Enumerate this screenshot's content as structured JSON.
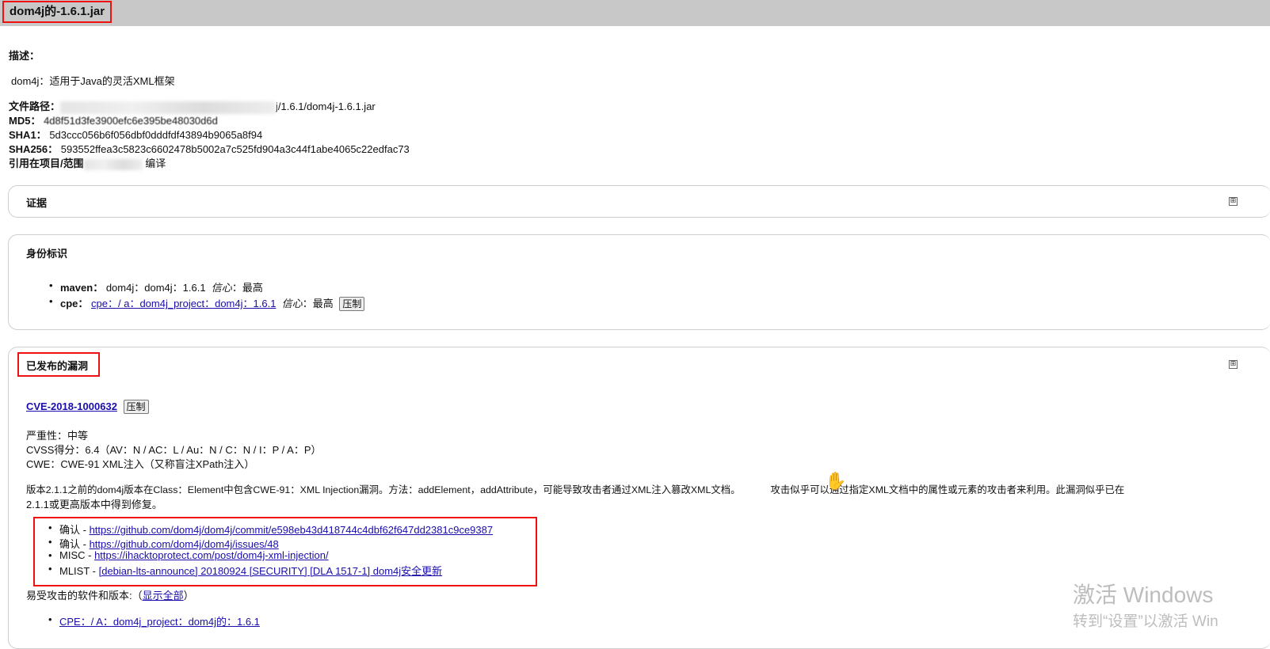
{
  "header": {
    "title": "dom4j的-1.6.1.jar"
  },
  "description": {
    "label": "描述：",
    "text": "dom4j：适用于Java的灵活XML框架"
  },
  "file_path": {
    "label": "文件路径：",
    "suffix": "j/1.6.1/dom4j-1.6.1.jar"
  },
  "md5": {
    "label": "MD5：",
    "value": "4d8f51d3fe3900efc6e395be48030d6d"
  },
  "sha1": {
    "label": "SHA1：",
    "value": "5d3ccc056b6f056dbf0dddfdf43894b9065a8f94"
  },
  "sha256": {
    "label": "SHA256：",
    "value": "593552ffea3c5823c6602478b5002a7c525fd904a3c44f1abe4065c22edfac73"
  },
  "scope": {
    "label": "引用在项目/范围",
    "value": "编译"
  },
  "evidence": {
    "title": "证据",
    "toggle": "⊞"
  },
  "identity": {
    "title": "身份标识",
    "maven": {
      "label": "maven：",
      "value": "dom4j：dom4j：1.6.1",
      "conf_label": "信心",
      "conf_value": "：最高"
    },
    "cpe": {
      "label": "cpe：",
      "link": "cpe：/ a：dom4j_project：dom4j：1.6.1",
      "conf_label": "信心",
      "conf_value": "：最高",
      "suppress": "压制"
    }
  },
  "vulns": {
    "title": "已发布的漏洞",
    "toggle": "⊞",
    "cve_id": "CVE-2018-1000632",
    "suppress": "压制",
    "severity": "严重性：中等",
    "cvss": "CVSS得分：6.4（AV：N / AC：L / Au：N / C：N / I：P / A：P）",
    "cwe": "CWE：CWE-91 XML注入（又称盲注XPath注入）",
    "desc_line1a": "版本2.1.1之前的dom4j版本在Class：Element中包含CWE-91：XML Injection漏洞。方法：addElement，addAttribute，可能导致攻击者通过XML注入篡改XML文档。",
    "desc_line1b": "攻击似乎可以通过指定XML文档中的属性或元素的攻击者来利用。此漏洞似乎已在",
    "desc_line2": "2.1.1或更高版本中得到修复。",
    "refs": [
      {
        "type": "确认 - ",
        "url": "https://github.com/dom4j/dom4j/commit/e598eb43d418744c4dbf62f647dd2381c9ce9387"
      },
      {
        "type": "确认 - ",
        "url": "https://github.com/dom4j/dom4j/issues/48"
      },
      {
        "type": "MISC - ",
        "url": "https://ihacktoprotect.com/post/dom4j-xml-injection/"
      },
      {
        "type": "MLIST - ",
        "url": "[debian-lts-announce] 20180924 [SECURITY] [DLA 1517-1] dom4j安全更新"
      }
    ],
    "vulnerable_label": "易受攻击的软件和版本:（",
    "show_all": "显示全部",
    "vulnerable_close": "）",
    "cpe_item": "CPE：/ A：dom4j_project：dom4j的：1.6.1"
  },
  "watermark": {
    "line1": "激活 Windows",
    "line2": "转到“设置”以激活 Win"
  }
}
